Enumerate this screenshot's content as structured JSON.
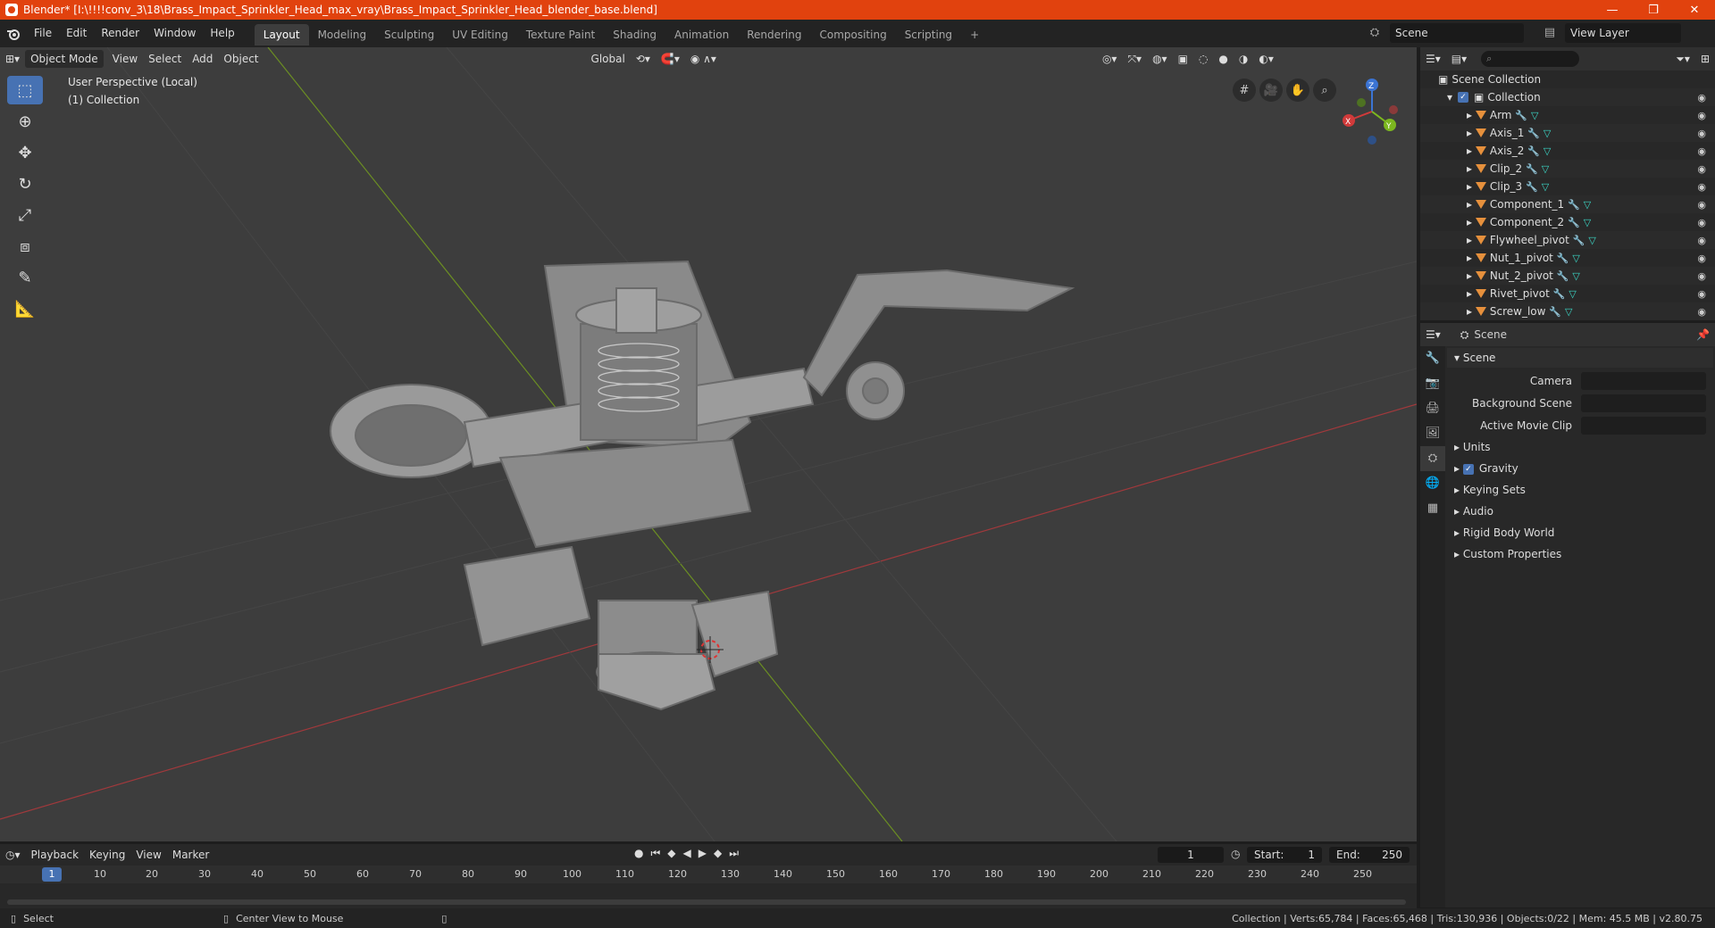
{
  "window": {
    "title": "Blender* [I:\\!!!!conv_3\\18\\Brass_Impact_Sprinkler_Head_max_vray\\Brass_Impact_Sprinkler_Head_blender_base.blend]",
    "minimize": "—",
    "maximize": "❐",
    "close": "✕"
  },
  "menu": [
    "File",
    "Edit",
    "Render",
    "Window",
    "Help"
  ],
  "workspaces": [
    "Layout",
    "Modeling",
    "Sculpting",
    "UV Editing",
    "Texture Paint",
    "Shading",
    "Animation",
    "Rendering",
    "Compositing",
    "Scripting"
  ],
  "active_workspace": "Layout",
  "scene_name": "Scene",
  "view_layer": "View Layer",
  "viewport": {
    "mode": "Object Mode",
    "menus": [
      "View",
      "Select",
      "Add",
      "Object"
    ],
    "orientation": "Global",
    "overlay_title": "User Perspective (Local)",
    "overlay_collection": "(1) Collection",
    "gizmo": {
      "x": "X",
      "y": "Y",
      "z": "Z"
    }
  },
  "outliner": {
    "search_placeholder": "",
    "root": "Scene Collection",
    "collection": "Collection",
    "items": [
      "Arm",
      "Axis_1",
      "Axis_2",
      "Clip_2",
      "Clip_3",
      "Component_1",
      "Component_2",
      "Flywheel_pivot",
      "Nut_1_pivot",
      "Nut_2_pivot",
      "Rivet_pivot",
      "Screw_low"
    ]
  },
  "properties": {
    "header": "Scene",
    "panel": "Scene",
    "camera_label": "Camera",
    "background_label": "Background Scene",
    "movieclip_label": "Active Movie Clip",
    "subpanels": [
      "Units",
      "Gravity",
      "Keying Sets",
      "Audio",
      "Rigid Body World",
      "Custom Properties"
    ]
  },
  "timeline": {
    "menus": [
      "Playback",
      "Keying",
      "View",
      "Marker"
    ],
    "current_frame": "1",
    "start_label": "Start:",
    "start": "1",
    "end_label": "End:",
    "end": "250",
    "ruler": [
      "1",
      "10",
      "20",
      "30",
      "40",
      "50",
      "60",
      "70",
      "80",
      "90",
      "100",
      "110",
      "120",
      "130",
      "140",
      "150",
      "160",
      "170",
      "180",
      "190",
      "200",
      "210",
      "220",
      "230",
      "240",
      "250"
    ]
  },
  "status": {
    "left": "Select",
    "middle": "Center View to Mouse",
    "right": "Collection | Verts:65,784 | Faces:65,468 | Tris:130,936 | Objects:0/22 | Mem: 45.5 MB | v2.80.75"
  }
}
